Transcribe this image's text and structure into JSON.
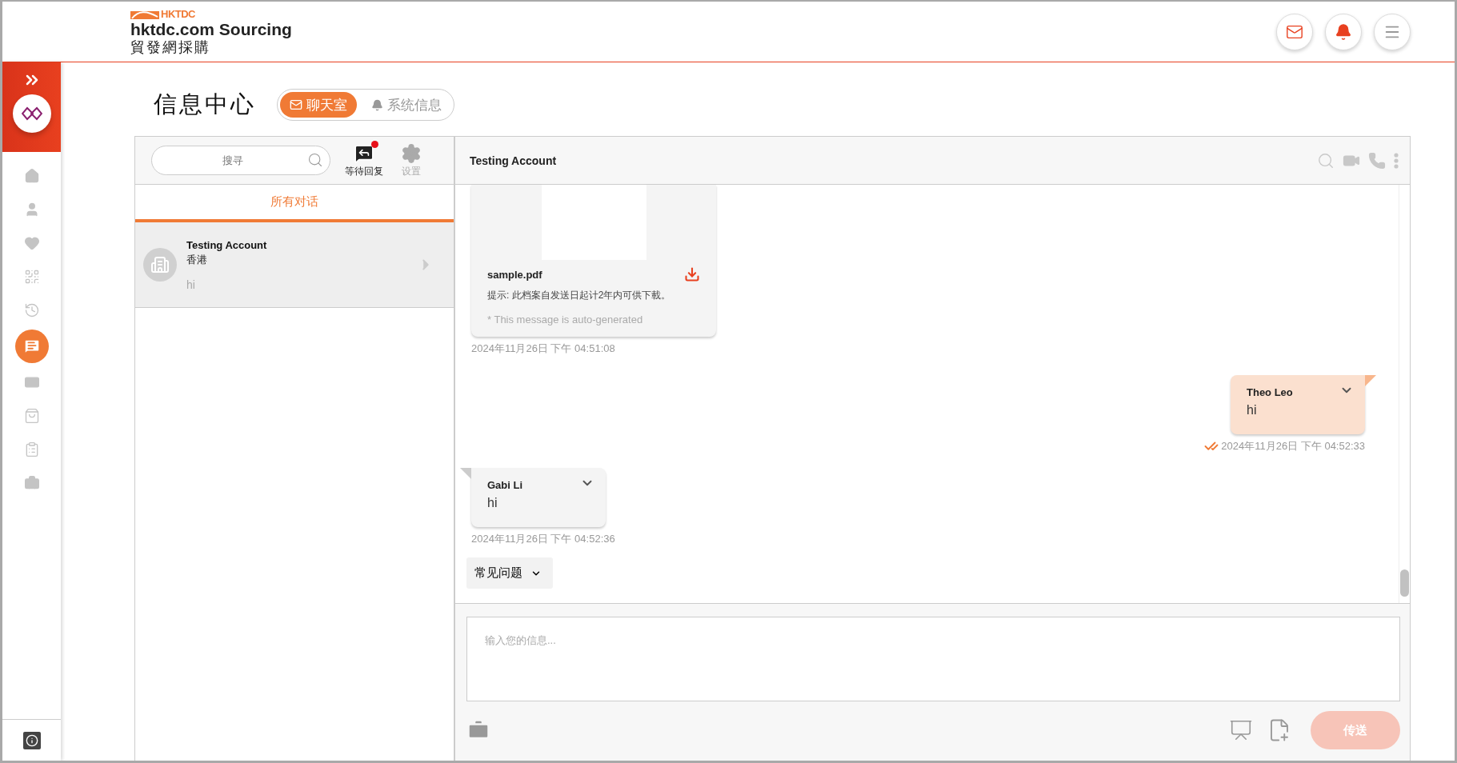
{
  "header": {
    "logo_mark": "HKTDC",
    "site_name": "hktdc.com Sourcing",
    "site_name_zh": "貿發網採購",
    "actions": [
      {
        "kind": "mail"
      },
      {
        "kind": "bell"
      },
      {
        "kind": "menu"
      }
    ]
  },
  "sidebar": {
    "items": [
      {
        "selected": false
      },
      {
        "selected": false
      },
      {
        "selected": false
      },
      {
        "selected": false
      },
      {
        "selected": false
      },
      {
        "selected": true
      },
      {
        "selected": false
      },
      {
        "selected": false
      },
      {
        "selected": false
      },
      {
        "selected": false
      }
    ]
  },
  "page": {
    "title": "信息中心",
    "tabs": [
      {
        "label": "聊天室",
        "selected": true
      },
      {
        "label": "系统信息",
        "selected": false
      }
    ]
  },
  "left_panel": {
    "search": {
      "placeholder": "搜寻"
    },
    "actions": [
      {
        "label": "等待回复",
        "active": true,
        "badge": true
      },
      {
        "label": "设置",
        "active": false,
        "badge": false
      }
    ],
    "filters": [
      {
        "label": "所有对话",
        "selected": true
      }
    ],
    "conversations": [
      {
        "name": "Testing Account",
        "location": "香港",
        "preview": "hi",
        "selected": true
      }
    ]
  },
  "chat": {
    "title": "Testing Account",
    "messages": [
      {
        "kind": "file",
        "filename": "sample.pdf",
        "note": "提示: 此档案自发送日起计2年内可供下載。",
        "auto_note": "* This message is auto-generated",
        "time": "2024年11月26日 下午 04:51:08"
      },
      {
        "kind": "sent",
        "sender": "Theo Leo",
        "text": "hi",
        "read": true,
        "time": "2024年11月26日 下午 04:52:33"
      },
      {
        "kind": "received",
        "sender": "Gabi Li",
        "text": "hi",
        "read": false,
        "time": "2024年11月26日 下午 04:52:36"
      }
    ],
    "faq_button": "常见问题",
    "composer": {
      "placeholder": "输入您的信息..."
    },
    "send_button": {
      "label": "传送",
      "disabled": true
    }
  }
}
